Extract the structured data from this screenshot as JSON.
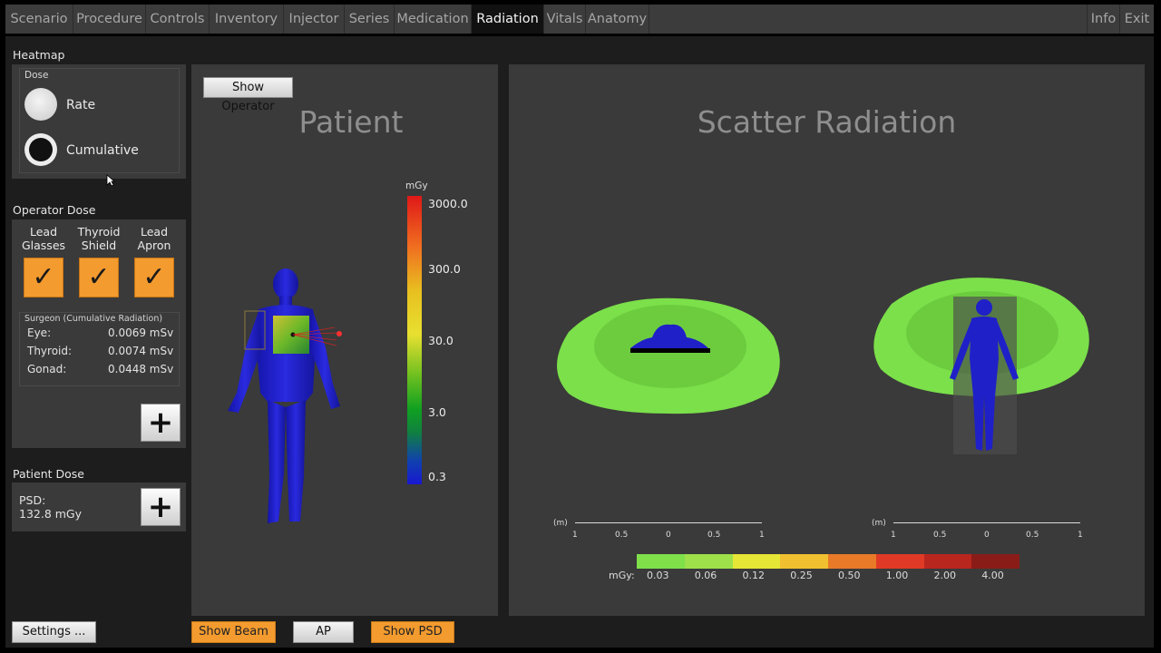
{
  "nav": {
    "tabs": [
      {
        "label": "Scenario"
      },
      {
        "label": "Procedure"
      },
      {
        "label": "Controls"
      },
      {
        "label": "Inventory"
      },
      {
        "label": "Injector"
      },
      {
        "label": "Series"
      },
      {
        "label": "Medication"
      },
      {
        "label": "Radiation"
      },
      {
        "label": "Vitals"
      },
      {
        "label": "Anatomy"
      }
    ],
    "active_tab": "Radiation",
    "info": "Info",
    "exit": "Exit"
  },
  "heatmap": {
    "title": "Heatmap",
    "dose_label": "Dose",
    "options": [
      {
        "label": "Rate",
        "selected": false
      },
      {
        "label": "Cumulative",
        "selected": true
      }
    ]
  },
  "operator_dose": {
    "title": "Operator Dose",
    "protections": [
      {
        "label_1": "Lead",
        "label_2": "Glasses",
        "checked": true
      },
      {
        "label_1": "Thyroid",
        "label_2": "Shield",
        "checked": true
      },
      {
        "label_1": "Lead",
        "label_2": "Apron",
        "checked": true
      }
    ],
    "surgeon_title": "Surgeon (Cumulative Radiation)",
    "rows": [
      {
        "label": "Eye:",
        "value": "0.0069 mSv"
      },
      {
        "label": "Thyroid:",
        "value": "0.0074 mSv"
      },
      {
        "label": "Gonad:",
        "value": "0.0448 mSv"
      }
    ]
  },
  "patient_dose": {
    "title": "Patient Dose",
    "psd_label": "PSD:",
    "psd_value": "132.8 mGy"
  },
  "patient_view": {
    "title": "Patient",
    "show_operator": "Show Operator",
    "colorbar_unit": "mGy",
    "colorbar_ticks": [
      "3000.0",
      "300.0",
      "30.0",
      "3.0",
      "0.3"
    ]
  },
  "scatter_view": {
    "title": "Scatter Radiation",
    "scale_unit": "(m)",
    "scale_ticks": [
      "1",
      "0.5",
      "0",
      "0.5",
      "1"
    ],
    "legend_unit": "mGy:",
    "legend_values": [
      "0.03",
      "0.06",
      "0.12",
      "0.25",
      "0.50",
      "1.00",
      "2.00",
      "4.00"
    ],
    "legend_colors": [
      "#7fe04a",
      "#9ee04a",
      "#e6e636",
      "#f0c030",
      "#e87a28",
      "#e03a26",
      "#b8261e",
      "#8a1c18"
    ]
  },
  "bottom": {
    "settings": "Settings ...",
    "show_beam": "Show Beam",
    "ap": "AP",
    "show_psd": "Show PSD"
  }
}
